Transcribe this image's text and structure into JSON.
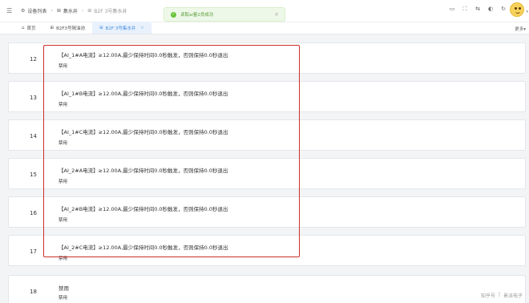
{
  "header": {
    "breadcrumbs": [
      "设备列表",
      "集水井",
      "B2F 3号集水井"
    ],
    "toast": "读取ai量2员成功"
  },
  "tabs": [
    {
      "label": "首页"
    },
    {
      "label": "B2F3号隔油池"
    },
    {
      "label": "B2F 3号集水井",
      "active": true
    }
  ],
  "more_label": "更多",
  "rows": [
    {
      "num": "12",
      "rule": "【AI_1#A电流】≥12.00A,最少保持时间0.0秒触发，否则保持0.0秒退出",
      "status": "禁用"
    },
    {
      "num": "13",
      "rule": "【AI_1#B电流】≥12.00A,最少保持时间0.0秒触发，否则保持0.0秒退出",
      "status": "禁用"
    },
    {
      "num": "14",
      "rule": "【AI_1#C电流】≥12.00A,最少保持时间0.0秒触发，否则保持0.0秒退出",
      "status": "禁用"
    },
    {
      "num": "15",
      "rule": "【AI_2#A电流】≥12.00A,最少保持时间0.0秒触发，否则保持0.0秒退出",
      "status": "禁用"
    },
    {
      "num": "16",
      "rule": "【AI_2#B电流】≥12.00A,最少保持时间0.0秒触发，否则保持0.0秒退出",
      "status": "禁用"
    },
    {
      "num": "17",
      "rule": "【AI_2#C电流】≥12.00A,最少保持时间0.0秒触发，否则保持0.0秒退出",
      "status": "禁用"
    },
    {
      "num": "18",
      "rule": "禁用",
      "status": "禁用"
    }
  ],
  "watermark": [
    "知乎号",
    "景派电子"
  ],
  "colors": {
    "accent": "#4a8fe0",
    "highlight_box": "#c9302c",
    "toast_green": "#67c23a"
  }
}
